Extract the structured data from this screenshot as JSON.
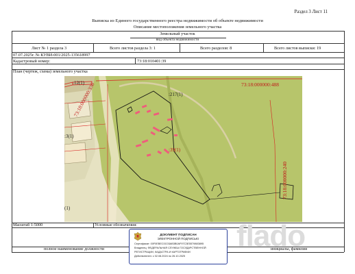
{
  "header": {
    "section_sheet": "Раздел 3    Лист 11",
    "title": "Выписка из Единого государственного реестра недвижимости об объекте недвижимости",
    "subtitle": "Описание местоположения земельного участка"
  },
  "object": {
    "name": "Земельный участок",
    "caption": "вид объекта недвижимости"
  },
  "sheet_row": {
    "sheet": "Лист № 1 раздела 3",
    "total_sheets_section": "Всего листов раздела 3: 1",
    "total_sections": "Всего разделов: 8",
    "total_sheets": "Всего листов выписки: 19"
  },
  "doc_ref": "07.07.2025г. № КУВИ-001/2025-135618997",
  "cadastral": {
    "label": "Кадастровый номер:",
    "value": "73:18:010401:39"
  },
  "plan_label": "План (чертеж, схема) земельного участка",
  "map": {
    "labels": {
      "top_left_parcel": ":12(1)",
      "top_left_block": "73:18:000000:336",
      "top_right_block": "73:18:000000:488",
      "top_parcel": ":217(1)",
      "center_parcel": ":39(1)",
      "right_block": "73:18:000000:240",
      "left_parcel": ":3(1)",
      "bottom_left_parcel": "(1)"
    },
    "colors": {
      "background": "#e4e3c6",
      "field": "#b9c46a",
      "parcel_line": "#111111",
      "building": "#ef5d7c",
      "block_line": "#d81e1e",
      "road": "#f1ead0"
    }
  },
  "bottom_row": {
    "scale": "Масштаб 1:5000",
    "legend": "Условные обозначения:"
  },
  "signature_row": {
    "position": "полное наименование должности",
    "name": "инициалы, фамилия"
  },
  "stamp": {
    "title": "ДОКУМЕНТ ПОДПИСАН",
    "subtitle": "ЭЛЕКТРОННОЙ ПОДПИСЬЮ",
    "line1": "Сертификат: 00F0EBEC0C03AB3B0AF97C3E5579883895",
    "line2": "Владелец: ФЕДЕРАЛЬНАЯ СЛУЖБА ГОСУДАРСТВЕННОЙ",
    "line3": "РЕГИСТРАЦИИ, КАДАСТРА И КАРТОГРАФИИ",
    "line4": "Действителен: с 02.08.2024 по 26.10.2025"
  },
  "watermark": "flado"
}
